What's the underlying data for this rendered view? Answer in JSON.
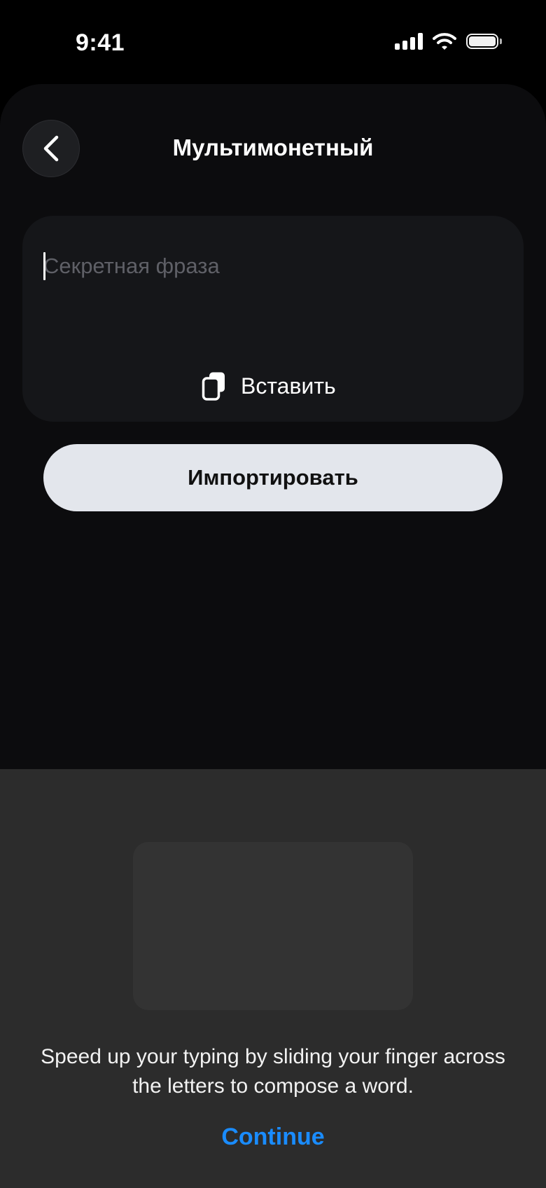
{
  "status_bar": {
    "time": "9:41",
    "icons": [
      "cellular-signal-icon",
      "wifi-icon",
      "battery-icon"
    ]
  },
  "header": {
    "back_icon": "chevron-left-icon",
    "title": "Мультимонетный"
  },
  "phrase_card": {
    "input_value": "",
    "placeholder": "Секретная фраза",
    "paste_icon": "clipboard-icon",
    "paste_label": "Вставить"
  },
  "import_button": {
    "label": "Импортировать"
  },
  "keyboard_tip": {
    "text": "Speed up your typing by sliding your finger across the letters to compose a word.",
    "continue_label": "Continue"
  },
  "colors": {
    "background": "#000000",
    "card": "#151619",
    "button": "#e3e6ec",
    "accent": "#1a8cff",
    "tip_panel": "#2c2c2c"
  }
}
